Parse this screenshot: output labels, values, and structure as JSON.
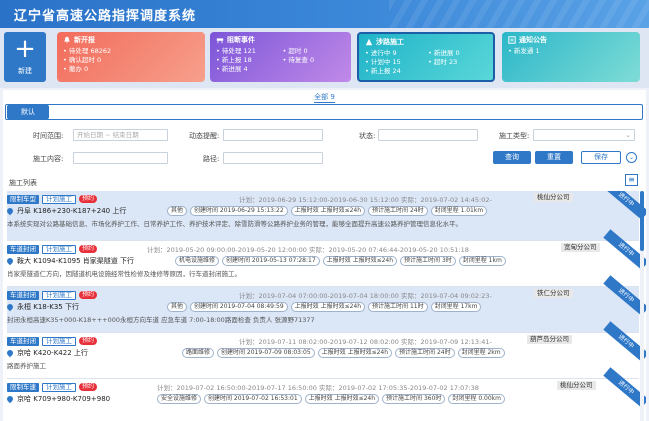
{
  "app": {
    "title": "辽宁省高速公路指挥调度系统"
  },
  "new_button": {
    "label": "新建"
  },
  "cards": {
    "new_report": {
      "title": "新开报",
      "rows": [
        "待处理 68262",
        "确认超时 0",
        "撤办 0"
      ]
    },
    "block_event": {
      "title": "阻断事件",
      "rows": [
        "待处理 121",
        "超时 0",
        "新上报 18",
        "待复查 0",
        "新进展 4"
      ]
    },
    "construction": {
      "title": "涉路施工",
      "rows": [
        "进行中 9",
        "新进展 0",
        "计划中 15",
        "超时 23",
        "新上报 24"
      ]
    },
    "notice": {
      "title": "通知公告",
      "rows": [
        "新发通 1"
      ]
    }
  },
  "tabs": {
    "all_label": "全部 9",
    "default_label": "默认"
  },
  "filters": {
    "time_range_label": "时间范围:",
    "start_date_placeholder": "开始日期",
    "to_text": "~",
    "end_date_placeholder": "结束日期",
    "dynamic_alert_label": "动态提醒:",
    "status_label": "状态:",
    "construction_type_label": "施工类型:",
    "construction_content_label": "施工内容:",
    "route_label": "路径:",
    "query_button": "查询",
    "reset_button": "重置",
    "save_button": "保存"
  },
  "list": {
    "title": "施工列表",
    "items": [
      {
        "type_tag": "限制车型",
        "plan_tag": "计划施工",
        "warn_tag": "预约",
        "plan_time": "计划：2019-06-29 15:12:00-2019-06-30 15:12:00    实际：2019-07-02 14:45:02-",
        "company": "桃仙分公司",
        "location": "丹阜 K186+230-K187+240 上行",
        "chips": [
          "其他",
          "创建时间 2019-06-29 15:13:22",
          "上报时效 上报时效≤24h",
          "预计施工时间 24时",
          "封闭里程 1.01km"
        ],
        "desc": "本系统实现对公路基础信息、市场化养护工作、日常养护工作、养护技术评定、除雪防滑等公路养护业务的管理，能够全面提升高速公路养护管理信息化水平。",
        "status": "进行中"
      },
      {
        "type_tag": "车道封闭",
        "plan_tag": "计划施工",
        "warn_tag": "预约",
        "plan_time": "计划：2019-05-20 09:00:00-2019-05-20 12:00:00    实际：2019-05-20 07:46:44-2019-05-20 10:51:18",
        "company": "宽甸分公司",
        "location": "鞍大 K1094-K1095 肖家渠隧道 下行",
        "chips": [
          "机电设施维修",
          "创建时间 2019-05-13 07:28:17",
          "上报时效 上报时效≤24h",
          "预计施工时间 3时",
          "封闭里程 1km"
        ],
        "desc": "肖家渠隧道仁方向，因隧道机电设施经常性检修及维修等原因，行车道封闭施工。",
        "status": "进行中"
      },
      {
        "type_tag": "车道封闭",
        "plan_tag": "计划施工",
        "warn_tag": "预约",
        "plan_time": "计划：2019-07-04 07:00:00-2019-07-04 18:00:00    实际：2019-07-04 09:02:23-",
        "company": "铁仁分公司",
        "location": "永桓 K18-K35 下行",
        "chips": [
          "其他",
          "创建时间 2019-07-04 08:49:59",
          "上报时效 上报时效≤24h",
          "预计施工时间 11时",
          "封闭里程 17km"
        ],
        "desc": "封闭永桓高速K35+000-K18+++000永桓方向车道 应急车道 7:00-18:00路面检查 负责人 张源野71377",
        "status": "进行中"
      },
      {
        "type_tag": "车道封闭",
        "plan_tag": "计划施工",
        "warn_tag": "预约",
        "plan_time": "计划：2019-07-11 08:02:00-2019-07-12 08:02:00    实际：2019-07-09 12:13:41-",
        "company": "葫芦岛分公司",
        "location": "京哈 K420-K422 上行",
        "chips": [
          "路面维修",
          "创建时间 2019-07-09 08:03:05",
          "上报时效 上报时效≤24h",
          "预计施工时间 24时",
          "封闭里程 2km"
        ],
        "desc": "路面养护施工",
        "status": "进行中"
      },
      {
        "type_tag": "限制车速",
        "plan_tag": "计划施工",
        "warn_tag": "预约",
        "plan_time": "计划：2019-07-02 16:50:00-2019-07-17 16:50:00    实际：2019-07-02 17:05:35-2019-07-02 17:07:38",
        "company": "桃仙分公司",
        "location": "京哈 K709+980-K709+980",
        "chips": [
          "安全设施维修",
          "创建时间 2019-07-02 16:53:01",
          "上报时效 上报时效≤24h",
          "预计施工时间 360时",
          "封闭里程 0.00km"
        ],
        "desc": "",
        "status": "进行中"
      }
    ]
  }
}
